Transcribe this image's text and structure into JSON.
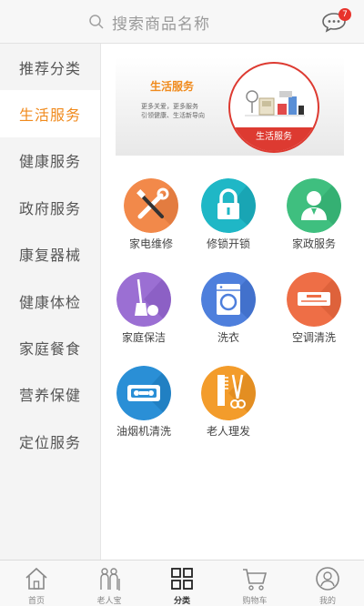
{
  "header": {
    "search_placeholder": "搜索商品名称",
    "message_badge": "7",
    "icons": [
      "search-icon",
      "message-icon"
    ]
  },
  "sidebar": {
    "items": [
      {
        "label": "推荐分类",
        "active": false
      },
      {
        "label": "生活服务",
        "active": true
      },
      {
        "label": "健康服务",
        "active": false
      },
      {
        "label": "政府服务",
        "active": false
      },
      {
        "label": "康复器械",
        "active": false
      },
      {
        "label": "健康体检",
        "active": false
      },
      {
        "label": "家庭餐食",
        "active": false
      },
      {
        "label": "营养保健",
        "active": false
      },
      {
        "label": "定位服务",
        "active": false
      }
    ]
  },
  "banner": {
    "title": "生活服务",
    "line1": "更多关爱，更多服务",
    "line2": "引领健康、生活新导向",
    "circle_label": "生活服务"
  },
  "services": [
    {
      "label": "家电维修",
      "icon": "tools-icon",
      "color": "#f2894a"
    },
    {
      "label": "修锁开锁",
      "icon": "lock-icon",
      "color": "#1fb7c6"
    },
    {
      "label": "家政服务",
      "icon": "person-icon",
      "color": "#3fbf7f"
    },
    {
      "label": "家庭保洁",
      "icon": "broom-icon",
      "color": "#9b6fd3"
    },
    {
      "label": "洗衣",
      "icon": "washing-machine-icon",
      "color": "#4e7fdc"
    },
    {
      "label": "空调清洗",
      "icon": "air-conditioner-icon",
      "color": "#ee6e46"
    },
    {
      "label": "油烟机清洗",
      "icon": "range-hood-icon",
      "color": "#2a8fd6"
    },
    {
      "label": "老人理发",
      "icon": "comb-scissors-icon",
      "color": "#f39c2b"
    }
  ],
  "bottom_nav": {
    "items": [
      {
        "label": "首页",
        "icon": "home-icon",
        "active": false
      },
      {
        "label": "老人宝",
        "icon": "elderly-icon",
        "active": false
      },
      {
        "label": "分类",
        "icon": "category-grid-icon",
        "active": true
      },
      {
        "label": "购物车",
        "icon": "cart-icon",
        "active": false
      },
      {
        "label": "我的",
        "icon": "profile-icon",
        "active": false
      }
    ]
  },
  "colors": {
    "accent": "#f08a1c",
    "badge": "#e8332c",
    "banner_red": "#dd3a31"
  }
}
